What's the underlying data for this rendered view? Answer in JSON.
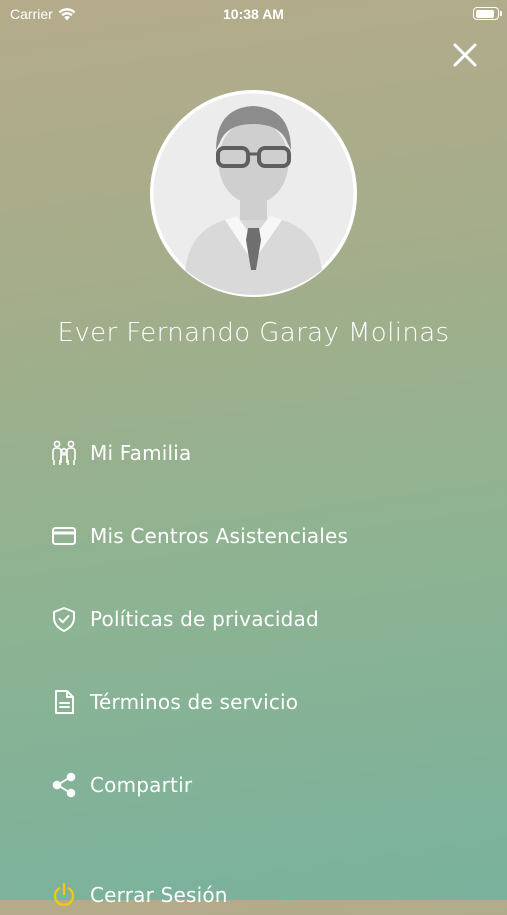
{
  "status_bar": {
    "carrier": "Carrier",
    "time": "10:38 AM"
  },
  "profile": {
    "name": "Ever Fernando Garay Molinas"
  },
  "menu": [
    {
      "label": "Mi Familia",
      "icon": "family-icon"
    },
    {
      "label": "Mis Centros Asistenciales",
      "icon": "card-icon"
    },
    {
      "label": "Políticas de privacidad",
      "icon": "shield-check-icon"
    },
    {
      "label": "Términos de servicio",
      "icon": "document-icon"
    },
    {
      "label": "Compartir",
      "icon": "share-icon"
    },
    {
      "label": "Cerrar Sesión",
      "icon": "power-icon"
    }
  ],
  "colors": {
    "logout_icon": "#f5c518",
    "text": "#ffffff"
  }
}
